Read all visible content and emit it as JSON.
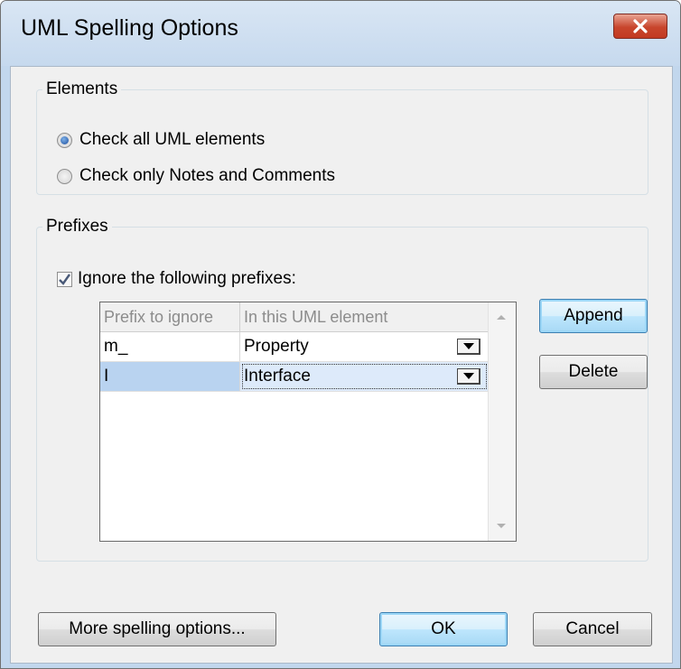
{
  "window": {
    "title": "UML Spelling Options"
  },
  "elements_group": {
    "legend": "Elements",
    "options": [
      {
        "label": "Check all UML elements",
        "checked": true
      },
      {
        "label": "Check only Notes and Comments",
        "checked": false
      }
    ]
  },
  "prefixes_group": {
    "legend": "Prefixes",
    "ignore_checkbox": {
      "label": "Ignore the following prefixes:",
      "checked": true
    },
    "table": {
      "headers": [
        "Prefix to ignore",
        "In this UML element"
      ],
      "rows": [
        {
          "prefix": "m_",
          "element": "Property",
          "selected": false
        },
        {
          "prefix": "I",
          "element": "Interface",
          "selected": true
        }
      ]
    },
    "append_label": "Append",
    "delete_label": "Delete"
  },
  "footer": {
    "more_label": "More spelling options...",
    "ok_label": "OK",
    "cancel_label": "Cancel"
  }
}
